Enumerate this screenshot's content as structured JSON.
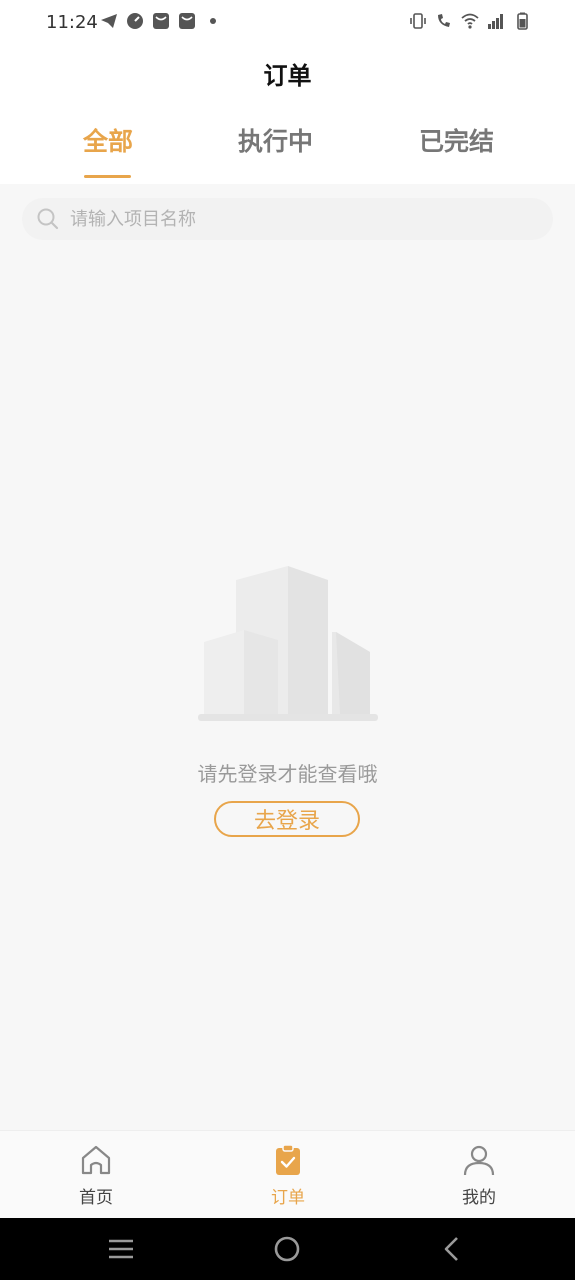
{
  "status_bar": {
    "time": "11:24",
    "left_icons": [
      "telegram-icon",
      "speedometer-icon",
      "mail-icon",
      "mail-icon",
      "dot-icon"
    ],
    "right_icons": [
      "vibrate-icon",
      "wifi-calling-icon",
      "wifi-icon",
      "signal-icon",
      "battery-icon"
    ]
  },
  "header": {
    "title": "订单",
    "tabs": [
      {
        "label": "全部",
        "active": true
      },
      {
        "label": "执行中",
        "active": false
      },
      {
        "label": "已完结",
        "active": false
      }
    ]
  },
  "search": {
    "placeholder": "请输入项目名称",
    "value": ""
  },
  "empty_state": {
    "illustration": "buildings-illustration",
    "message": "请先登录才能查看哦",
    "login_button": "去登录"
  },
  "tabbar": {
    "items": [
      {
        "label": "首页",
        "icon": "home-icon",
        "active": false
      },
      {
        "label": "订单",
        "icon": "clipboard-check-icon",
        "active": true
      },
      {
        "label": "我的",
        "icon": "user-icon",
        "active": false
      }
    ]
  },
  "nav": {
    "buttons": [
      "recent-apps-icon",
      "home-circle-icon",
      "back-icon"
    ]
  },
  "colors": {
    "accent": "#e8a54b",
    "background": "#f7f7f7"
  }
}
